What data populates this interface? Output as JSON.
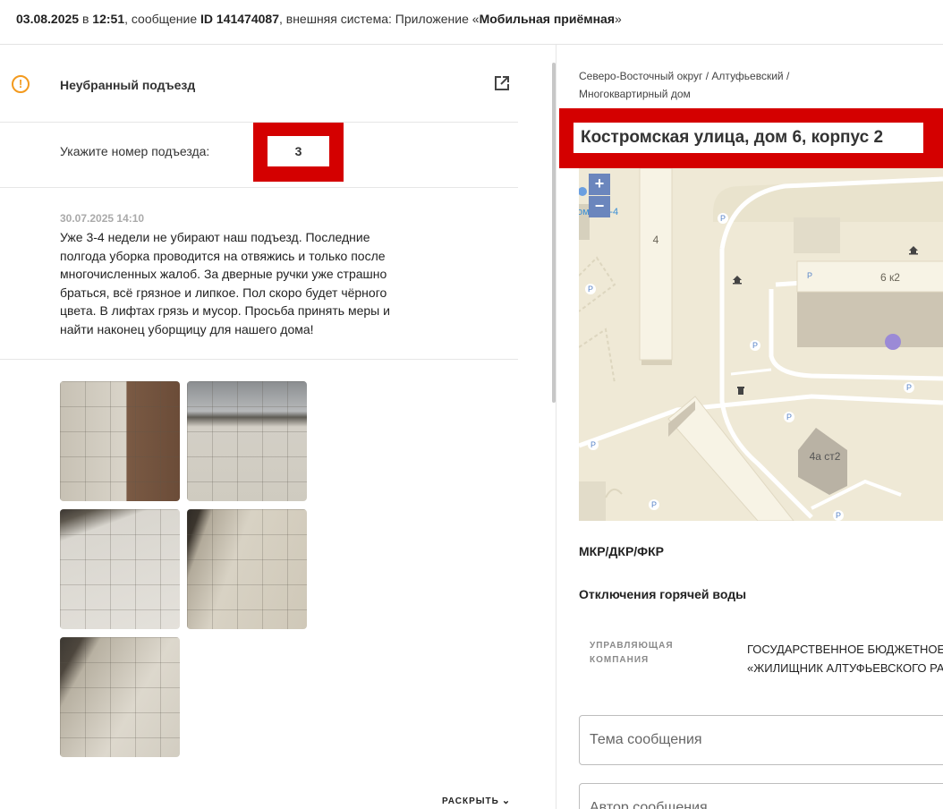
{
  "header": {
    "date": "03.08.2025",
    "sep_in": " в ",
    "time": "12:51",
    "msg_prefix": ", сообщение ",
    "msg_id": "ID 141474087",
    "system_prefix": ", внешняя система: Приложение «",
    "system_name": "Мобильная приёмная",
    "system_suffix": "»"
  },
  "category": {
    "icon": "warning-icon",
    "title": "Неубранный подъезд",
    "open_icon": "open-in-new-icon"
  },
  "entrance": {
    "label": "Укажите номер подъезда:",
    "value": "3"
  },
  "message": {
    "datetime": "30.07.2025 14:10",
    "text": "Уже 3-4 недели не убирают наш подъезд. Последние полгода уборка проводится на отвяжись и только после многочисленных жалоб. За дверные ручки уже страшно браться, всё грязное и липкое. Пол скоро будет чёрного цвета. В лифтах грязь и мусор. Просьба принять меры и найти наконец уборщицу для нашего дома!"
  },
  "photos_count": 5,
  "expand_label": "РАСКРЫТЬ",
  "right": {
    "crumbs": "Северо-Восточный округ / Алтуфьевский / Многоквартирный дом",
    "address": "Костромская улица, дом 6, корпус 2",
    "map": {
      "zoom_in": "+",
      "zoom_out": "−",
      "labels": {
        "bldg4": "4",
        "bldg6k2": "6 к2",
        "bldg4a": "4а ст2",
        "street": "омская-4",
        "parking": "P"
      }
    },
    "mkr": "МКР/ДКР/ФКР",
    "hotwater": "Отключения горячей воды",
    "uk_label": "Управляющая компания",
    "uk_value_line1": "ГОСУДАРСТВЕННОЕ БЮДЖЕТНОЕ",
    "uk_value_line2": "«ЖИЛИЩНИК АЛТУФЬЕВСКОГО РА",
    "subject_placeholder": "Тема сообщения",
    "author_placeholder": "Автор сообщения"
  }
}
